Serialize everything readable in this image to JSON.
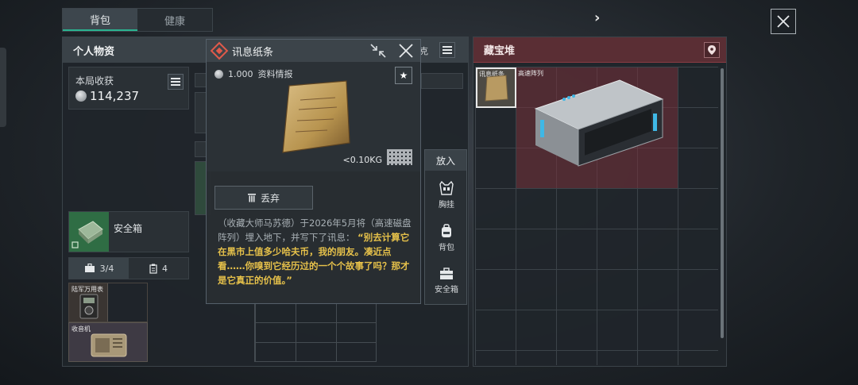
{
  "tabs": [
    {
      "label": "背包",
      "active": true
    },
    {
      "label": "健康",
      "active": false
    }
  ],
  "left_panel": {
    "title": "个人物资",
    "income_label": "本局收获",
    "income_value": "114,237",
    "safebox_label": "安全箱",
    "capacity": [
      {
        "icon": "briefcase-icon",
        "value": "3/4"
      },
      {
        "icon": "clipboard-icon",
        "value": "4"
      }
    ],
    "items": [
      {
        "label": "陆军万用表"
      },
      {
        "label": "收音机"
      }
    ],
    "partial_labels": [
      "克"
    ]
  },
  "popup": {
    "title": "讯息纸条",
    "price": "1.000",
    "category": "资料情报",
    "weight": "<0.10KG",
    "discard_label": "丢弃",
    "description_plain": "（收藏大师马苏德）于2026年5月将（高速磁盘阵列）埋入地下，并写下了讯息：",
    "description_quote": "“别去计算它在黑市上值多少哈夫币，我的朋友。凑近点看……你嗅到它经历过的一个个故事了吗？那才是它真正的价值。”"
  },
  "actions": {
    "title": "放入",
    "items": [
      {
        "label": "胸挂",
        "icon": "vest-icon"
      },
      {
        "label": "背包",
        "icon": "backpack-icon"
      },
      {
        "label": "安全箱",
        "icon": "safebox-icon"
      }
    ]
  },
  "right_panel": {
    "title": "藏宝堆",
    "items": [
      {
        "label": "讯息纸条"
      },
      {
        "label": "高速阵列"
      }
    ]
  },
  "colors": {
    "accent_green": "#2bb391",
    "treasure_red": "#5a2e34",
    "quote_gold": "#e6c14a"
  }
}
